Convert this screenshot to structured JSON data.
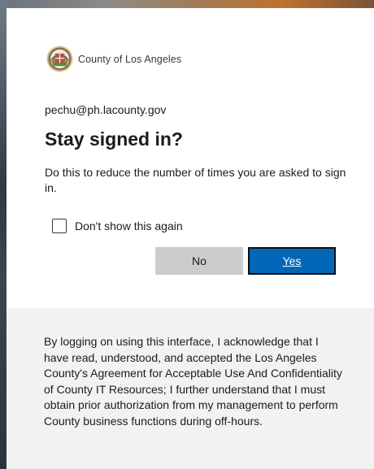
{
  "brand": {
    "name": "County of Los Angeles",
    "logo_icon": "county-seal-icon"
  },
  "identity": {
    "email": "pechu@ph.lacounty.gov"
  },
  "prompt": {
    "title": "Stay signed in?",
    "description": "Do this to reduce the number of times you are asked to sign in."
  },
  "kmsi": {
    "label": "Don't show this again",
    "checked": false
  },
  "buttons": {
    "no_label": "No",
    "yes_label": "Yes"
  },
  "footer": {
    "text": "By logging on using this interface, I acknowledge that I have read, understood, and accepted the Los Angeles County's Agreement for Acceptable Use And Confidentiality of County IT Resources; I further understand that I must obtain prior authorization from my management to perform County business functions during off-hours."
  },
  "colors": {
    "primary_button": "#0067b8",
    "secondary_button": "#cccccc",
    "footer_background": "#f2f2f2"
  }
}
